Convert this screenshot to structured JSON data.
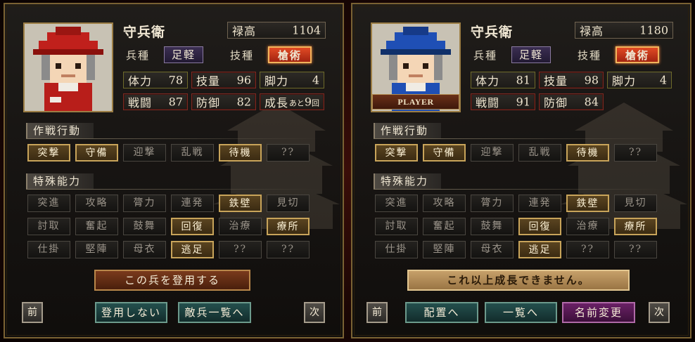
{
  "panels": [
    {
      "id": "left",
      "name": "守兵衛",
      "salary": {
        "label": "禄高",
        "value": "1104"
      },
      "troop": {
        "label": "兵種",
        "value": "足軽"
      },
      "skill": {
        "label": "技種",
        "value": "槍術"
      },
      "stats": {
        "hp": {
          "label": "体力",
          "value": "78"
        },
        "tech": {
          "label": "技量",
          "value": "96"
        },
        "legs": {
          "label": "脚力",
          "value": "4"
        },
        "battle": {
          "label": "戦闘",
          "value": "87"
        },
        "defense": {
          "label": "防御",
          "value": "82"
        },
        "growth": {
          "label": "成長",
          "prefix": "あと",
          "value": "9",
          "unit": "回"
        }
      },
      "tactics_title": "作戦行動",
      "tactics": [
        {
          "label": "突撃",
          "on": true
        },
        {
          "label": "守備",
          "on": true
        },
        {
          "label": "迎撃",
          "on": false
        },
        {
          "label": "乱戦",
          "on": false
        },
        {
          "label": "待機",
          "on": true
        },
        {
          "label": "??",
          "on": false
        }
      ],
      "abilities_title": "特殊能力",
      "abilities": [
        {
          "label": "突進",
          "on": false
        },
        {
          "label": "攻略",
          "on": false
        },
        {
          "label": "膂力",
          "on": false
        },
        {
          "label": "連発",
          "on": false
        },
        {
          "label": "鉄壁",
          "on": true
        },
        {
          "label": "見切",
          "on": false
        },
        {
          "label": "討取",
          "on": false
        },
        {
          "label": "奮起",
          "on": false
        },
        {
          "label": "鼓舞",
          "on": false
        },
        {
          "label": "回復",
          "on": true
        },
        {
          "label": "治療",
          "on": false
        },
        {
          "label": "療所",
          "on": true
        },
        {
          "label": "仕掛",
          "on": false
        },
        {
          "label": "堅陣",
          "on": false
        },
        {
          "label": "母衣",
          "on": false
        },
        {
          "label": "逃足",
          "on": true
        },
        {
          "label": "??",
          "on": false
        },
        {
          "label": "??",
          "on": false
        }
      ],
      "main_action": "この兵を登用する",
      "prev": "前",
      "next": "次",
      "footer_buttons": [
        "登用しない",
        "敵兵一覧へ"
      ]
    },
    {
      "id": "right",
      "name": "守兵衛",
      "player_label": "PLAYER",
      "salary": {
        "label": "禄高",
        "value": "1180"
      },
      "troop": {
        "label": "兵種",
        "value": "足軽"
      },
      "skill": {
        "label": "技種",
        "value": "槍術"
      },
      "stats": {
        "hp": {
          "label": "体力",
          "value": "81"
        },
        "tech": {
          "label": "技量",
          "value": "98"
        },
        "legs": {
          "label": "脚力",
          "value": "4"
        },
        "battle": {
          "label": "戦闘",
          "value": "91"
        },
        "defense": {
          "label": "防御",
          "value": "84"
        }
      },
      "tactics_title": "作戦行動",
      "tactics": [
        {
          "label": "突撃",
          "on": true
        },
        {
          "label": "守備",
          "on": true
        },
        {
          "label": "迎撃",
          "on": false
        },
        {
          "label": "乱戦",
          "on": false
        },
        {
          "label": "待機",
          "on": true
        },
        {
          "label": "??",
          "on": false
        }
      ],
      "abilities_title": "特殊能力",
      "abilities": [
        {
          "label": "突進",
          "on": false
        },
        {
          "label": "攻略",
          "on": false
        },
        {
          "label": "膂力",
          "on": false
        },
        {
          "label": "連発",
          "on": false
        },
        {
          "label": "鉄壁",
          "on": true
        },
        {
          "label": "見切",
          "on": false
        },
        {
          "label": "討取",
          "on": false
        },
        {
          "label": "奮起",
          "on": false
        },
        {
          "label": "鼓舞",
          "on": false
        },
        {
          "label": "回復",
          "on": true
        },
        {
          "label": "治療",
          "on": false
        },
        {
          "label": "療所",
          "on": true
        },
        {
          "label": "仕掛",
          "on": false
        },
        {
          "label": "堅陣",
          "on": false
        },
        {
          "label": "母衣",
          "on": false
        },
        {
          "label": "逃足",
          "on": true
        },
        {
          "label": "??",
          "on": false
        },
        {
          "label": "??",
          "on": false
        }
      ],
      "main_action": "これ以上成長できません。",
      "prev": "前",
      "next": "次",
      "footer_buttons": [
        "配置へ",
        "一覧へ",
        "名前変更"
      ]
    }
  ],
  "colors": {
    "frame": "#7a6233",
    "skill_red": "#e14a24",
    "troop_purple": "#3b2e52",
    "active_gold": "#c8a45a",
    "hat_left": "#c0201c",
    "hat_right": "#1f4fb5"
  }
}
